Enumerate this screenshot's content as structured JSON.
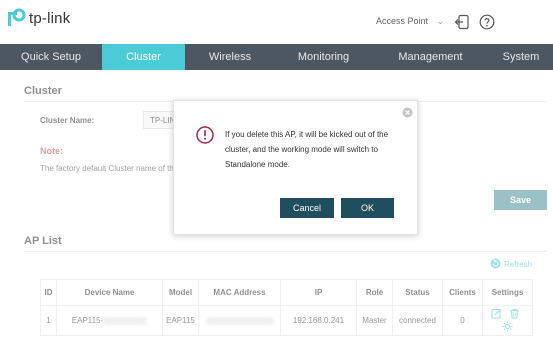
{
  "header": {
    "brand": "tp-link",
    "mode": "Access Point",
    "icons": [
      "logout-icon",
      "help-icon"
    ]
  },
  "nav": {
    "items": [
      "Quick Setup",
      "Cluster",
      "Wireless",
      "Monitoring",
      "Management",
      "System"
    ],
    "active": "Cluster"
  },
  "cluster": {
    "title": "Cluster",
    "name_label": "Cluster Name:",
    "name_value": "TP-LIN",
    "note_title": "Note:",
    "note_text": "The factory default Cluster name of th",
    "save_label": "Save"
  },
  "ap_list": {
    "title": "AP List",
    "refresh_label": "Refresh",
    "columns": [
      "ID",
      "Device Name",
      "Model",
      "MAC Address",
      "IP",
      "Role",
      "Status",
      "Clients",
      "Settings"
    ],
    "rows": [
      {
        "id": "1",
        "device_name": "EAP115-",
        "model": "EAP115",
        "ip": "192.168.0.241",
        "role": "Master",
        "status": "connected",
        "clients": "0"
      }
    ]
  },
  "dialog": {
    "message": "If you delete this AP, it will be kicked out of the cluster, and the working mode will switch to Standalone mode.",
    "cancel_label": "Cancel",
    "ok_label": "OK"
  },
  "colors": {
    "accent": "#4acbd6",
    "nav_bg": "#4d5761",
    "dialog_button": "#1f4e5f",
    "save_button": "#4a8c98",
    "warning": "#9b2b4f",
    "note": "#c94f53"
  }
}
